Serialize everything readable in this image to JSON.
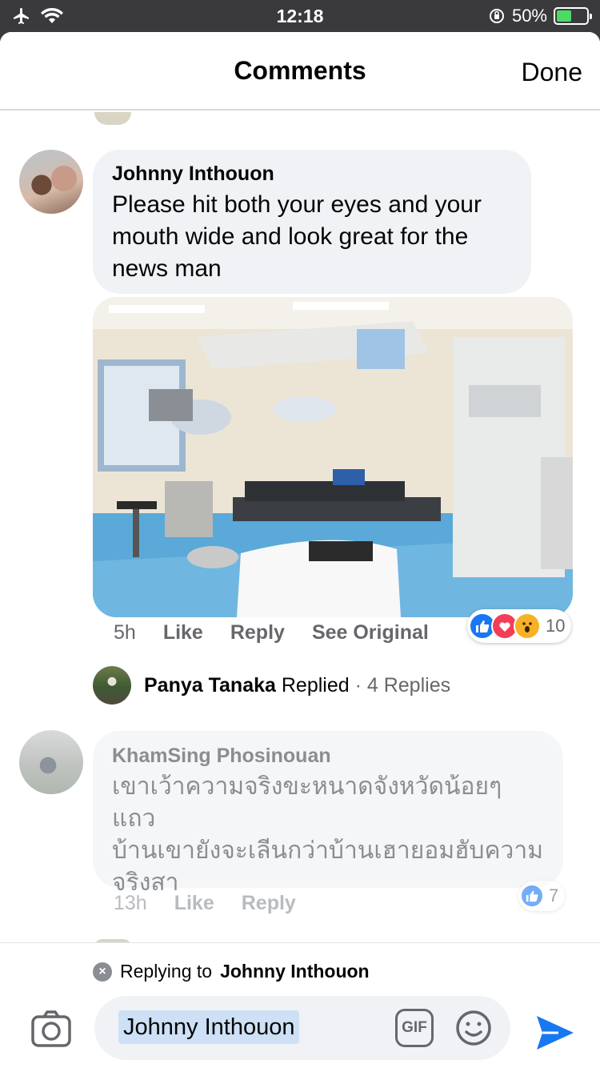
{
  "status_bar": {
    "time": "12:18",
    "battery_percent": "50%",
    "battery_level": 0.5,
    "icons": [
      "airplane-icon",
      "wifi-icon",
      "orientation-lock-icon",
      "battery-icon"
    ]
  },
  "header": {
    "title": "Comments",
    "done_label": "Done"
  },
  "comments": [
    {
      "author": "Johnny Inthouon",
      "text": "Please hit both your eyes and your mouth wide and look great for the news man",
      "time": "5h",
      "like_label": "Like",
      "reply_label": "Reply",
      "see_original_label": "See Original",
      "reaction_count": "10",
      "reaction_icons": [
        "like-icon",
        "love-icon",
        "wow-icon"
      ],
      "reply_summary": {
        "replier": "Panya Tanaka",
        "replied_label": "Replied",
        "separator": "·",
        "replies_label": "4 Replies"
      }
    },
    {
      "author": "KhamSing Phosinouan",
      "text_lines": [
        "เขาเว้าความจริงขะหนาดจังหวัดน้อยๆแถว",
        "บ้านเขายังจะเลีนกว่าบ้านเฮายอมฮับความ",
        "จริงสา"
      ],
      "time": "13h",
      "like_label": "Like",
      "reply_label": "Reply",
      "reaction_count": "7",
      "reaction_icons": [
        "like-icon"
      ]
    }
  ],
  "composer": {
    "replying_prefix": "Replying to",
    "replying_to": "Johnny Inthouon",
    "input_value": "Johnny Inthouon",
    "gif_label": "GIF"
  },
  "colors": {
    "accent_blue": "#1877f2",
    "bubble_bg": "#f0f2f5",
    "love_red": "#f33e58",
    "wow_yellow": "#f7b125"
  }
}
